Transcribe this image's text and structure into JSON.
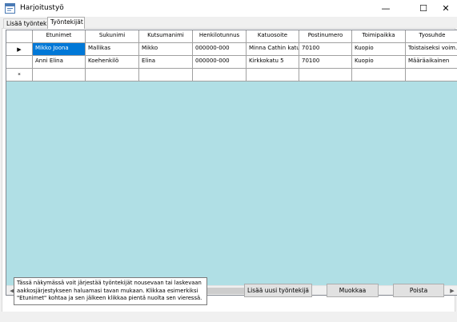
{
  "window": {
    "title": "Harjoitustyö",
    "minimize_glyph": "—",
    "maximize_glyph": "☐",
    "close_glyph": "✕"
  },
  "tabs": [
    {
      "label": "Lisää työntekijä"
    },
    {
      "label": "Työntekijät"
    }
  ],
  "grid": {
    "columns": [
      "Etunimet",
      "Sukunimi",
      "Kutsumanimi",
      "Henkilotunnus",
      "Katuosoite",
      "Postinumero",
      "Toimipaikka",
      "Tyosuhde"
    ],
    "rows": [
      [
        "Mikko Joona",
        "Mallikas",
        "Mikko",
        "000000-000",
        "Minna Cathin katu",
        "70100",
        "Kuopio",
        "Toistaiseksi voim..."
      ],
      [
        "Anni Elina",
        "Koehenkilö",
        "Elina",
        "000000-000",
        "Kirkkokatu 5",
        "70100",
        "Kuopio",
        "Määräaikainen"
      ]
    ],
    "current_row_glyph": "▶",
    "new_row_glyph": "*"
  },
  "info_text": "Tässä näkymässä voit järjestää työntekijät nousevaan tai laskevaan aakkosjärjestykseen haluamasi tavan mukaan. Klikkaa esimerkiksi \"Etunimet\" kohtaa ja sen jälkeen klikkaa pientä nuolta sen vieressä.",
  "buttons": {
    "add": "Lisää uusi työntekijä",
    "edit": "Muokkaa",
    "delete": "Poista"
  },
  "colors": {
    "accent": "#0078d7",
    "grid_background": "#b0dfe5"
  },
  "icons": {
    "app": "app-form-icon"
  }
}
